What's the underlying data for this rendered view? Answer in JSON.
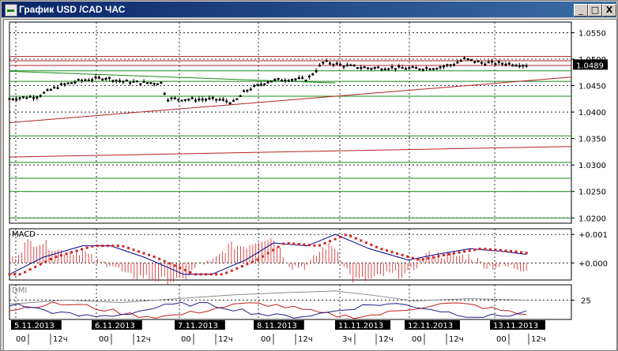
{
  "window": {
    "title": "График USD /CAD  ЧАС",
    "buttons": {
      "minimize": "_",
      "maximize": "□",
      "close": "X"
    }
  },
  "chart_data": [
    {
      "type": "candlestick",
      "pane": "price",
      "symbol": "USD/CAD",
      "timeframe": "ЧАС",
      "current_price": "1.0489",
      "y_ticks": [
        "1.0550",
        "1.0500",
        "1.0450",
        "1.0400",
        "1.0350",
        "1.0300",
        "1.0250",
        "1.0200"
      ],
      "ylim": [
        1.019,
        1.057
      ],
      "grid": true,
      "horizontal_levels_green": [
        1.0478,
        1.0458,
        1.043,
        1.0355,
        1.0305,
        1.0275,
        1.025,
        1.02
      ],
      "horizontal_levels_red": [
        1.0505,
        1.0497,
        1.0488
      ],
      "trend_lines": [
        {
          "color": "red",
          "from": {
            "x": 0,
            "y": 1.038
          },
          "to": {
            "x": 1,
            "y": 1.0466
          }
        },
        {
          "color": "red",
          "from": {
            "x": 0,
            "y": 1.0315
          },
          "to": {
            "x": 1,
            "y": 1.0335
          }
        },
        {
          "color": "green",
          "from": {
            "x": 0,
            "y": 1.0477
          },
          "to": {
            "x": 0.58,
            "y": 1.0455
          }
        }
      ],
      "series": [
        {
          "x": 0.0,
          "y": 1.0425
        },
        {
          "x": 0.05,
          "y": 1.043
        },
        {
          "x": 0.09,
          "y": 1.045
        },
        {
          "x": 0.13,
          "y": 1.046
        },
        {
          "x": 0.17,
          "y": 1.0465
        },
        {
          "x": 0.2,
          "y": 1.0458
        },
        {
          "x": 0.24,
          "y": 1.0455
        },
        {
          "x": 0.27,
          "y": 1.0455
        },
        {
          "x": 0.28,
          "y": 1.0425
        },
        {
          "x": 0.32,
          "y": 1.0424
        },
        {
          "x": 0.37,
          "y": 1.0424
        },
        {
          "x": 0.4,
          "y": 1.0418
        },
        {
          "x": 0.42,
          "y": 1.044
        },
        {
          "x": 0.46,
          "y": 1.0458
        },
        {
          "x": 0.49,
          "y": 1.0462
        },
        {
          "x": 0.53,
          "y": 1.0462
        },
        {
          "x": 0.56,
          "y": 1.0495
        },
        {
          "x": 0.6,
          "y": 1.0487
        },
        {
          "x": 0.64,
          "y": 1.0483
        },
        {
          "x": 0.68,
          "y": 1.0484
        },
        {
          "x": 0.72,
          "y": 1.0482
        },
        {
          "x": 0.76,
          "y": 1.0484
        },
        {
          "x": 0.79,
          "y": 1.049
        },
        {
          "x": 0.81,
          "y": 1.05
        },
        {
          "x": 0.84,
          "y": 1.0493
        },
        {
          "x": 0.88,
          "y": 1.0492
        },
        {
          "x": 0.92,
          "y": 1.0489
        }
      ]
    },
    {
      "type": "line",
      "pane": "indicator",
      "name": "MACD",
      "y_ticks": [
        "+0.001",
        "+0.000"
      ],
      "grid": true,
      "series": [
        {
          "x": 0.0,
          "y": -0.0004
        },
        {
          "x": 0.06,
          "y": 0.0002
        },
        {
          "x": 0.13,
          "y": 0.0006
        },
        {
          "x": 0.18,
          "y": 0.0006
        },
        {
          "x": 0.24,
          "y": 0.0002
        },
        {
          "x": 0.31,
          "y": -0.0004
        },
        {
          "x": 0.36,
          "y": -0.0004
        },
        {
          "x": 0.42,
          "y": 0.0001
        },
        {
          "x": 0.47,
          "y": 0.0007
        },
        {
          "x": 0.53,
          "y": 0.0006
        },
        {
          "x": 0.58,
          "y": 0.001
        },
        {
          "x": 0.64,
          "y": 0.0005
        },
        {
          "x": 0.71,
          "y": 0.0001
        },
        {
          "x": 0.76,
          "y": 0.0003
        },
        {
          "x": 0.82,
          "y": 0.0005
        },
        {
          "x": 0.88,
          "y": 0.0004
        },
        {
          "x": 0.92,
          "y": 0.0003
        }
      ]
    },
    {
      "type": "line",
      "pane": "indicator",
      "name": "DMI",
      "y_ticks": [
        "25"
      ],
      "grid": true,
      "series": [
        {
          "x": 0.0,
          "y": 20
        },
        {
          "x": 0.1,
          "y": 25
        },
        {
          "x": 0.2,
          "y": 22
        },
        {
          "x": 0.3,
          "y": 27
        },
        {
          "x": 0.4,
          "y": 32
        },
        {
          "x": 0.5,
          "y": 35
        },
        {
          "x": 0.58,
          "y": 37
        },
        {
          "x": 0.65,
          "y": 31
        },
        {
          "x": 0.72,
          "y": 24
        },
        {
          "x": 0.82,
          "y": 27
        },
        {
          "x": 0.92,
          "y": 25
        }
      ]
    }
  ],
  "time_axis": {
    "dates": [
      "5.11.2013",
      "6.11.2013",
      "7.11.2013",
      "8.11.2013",
      "11.11.2013",
      "12.11.2013",
      "13.11.2013"
    ],
    "hours": [
      "00",
      "12ч",
      "00",
      "12ч",
      "00",
      "12ч",
      "00",
      "12ч",
      "3ч",
      "12ч",
      "00",
      "12ч",
      "00",
      "12ч"
    ]
  },
  "colors": {
    "titlebar": "#0a246a",
    "up_candle": "#000000",
    "level_green": "#1a8a1a",
    "level_red": "#b22222",
    "macd_line": "#00008b",
    "macd_signal": "#d42020",
    "dmi_grey": "#888888"
  }
}
